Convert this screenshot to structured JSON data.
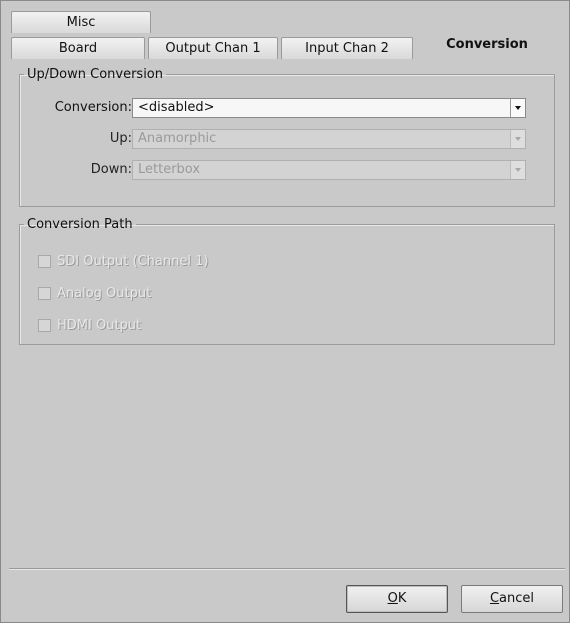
{
  "tabs": {
    "row_top": [
      {
        "label": "Misc"
      }
    ],
    "row_bottom": [
      {
        "label": "Board"
      },
      {
        "label": "Output Chan 1"
      },
      {
        "label": "Input Chan 2"
      },
      {
        "label": "Conversion",
        "active": true
      }
    ]
  },
  "updown": {
    "legend": "Up/Down Conversion",
    "conversion_label": "Conversion:",
    "conversion_value": "<disabled>",
    "up_label": "Up:",
    "up_value": "Anamorphic",
    "down_label": "Down:",
    "down_value": "Letterbox"
  },
  "path": {
    "legend": "Conversion Path",
    "options": [
      {
        "label": "SDI Output (Channel 1)",
        "checked": false,
        "enabled": false
      },
      {
        "label": "Analog Output",
        "checked": false,
        "enabled": false
      },
      {
        "label": "HDMI Output",
        "checked": false,
        "enabled": false
      }
    ]
  },
  "buttons": {
    "ok_mnemonic": "O",
    "ok_rest": "K",
    "cancel_mnemonic": "C",
    "cancel_rest": "ancel"
  },
  "icons": {
    "combo_arrow": "chevron-down-icon"
  }
}
